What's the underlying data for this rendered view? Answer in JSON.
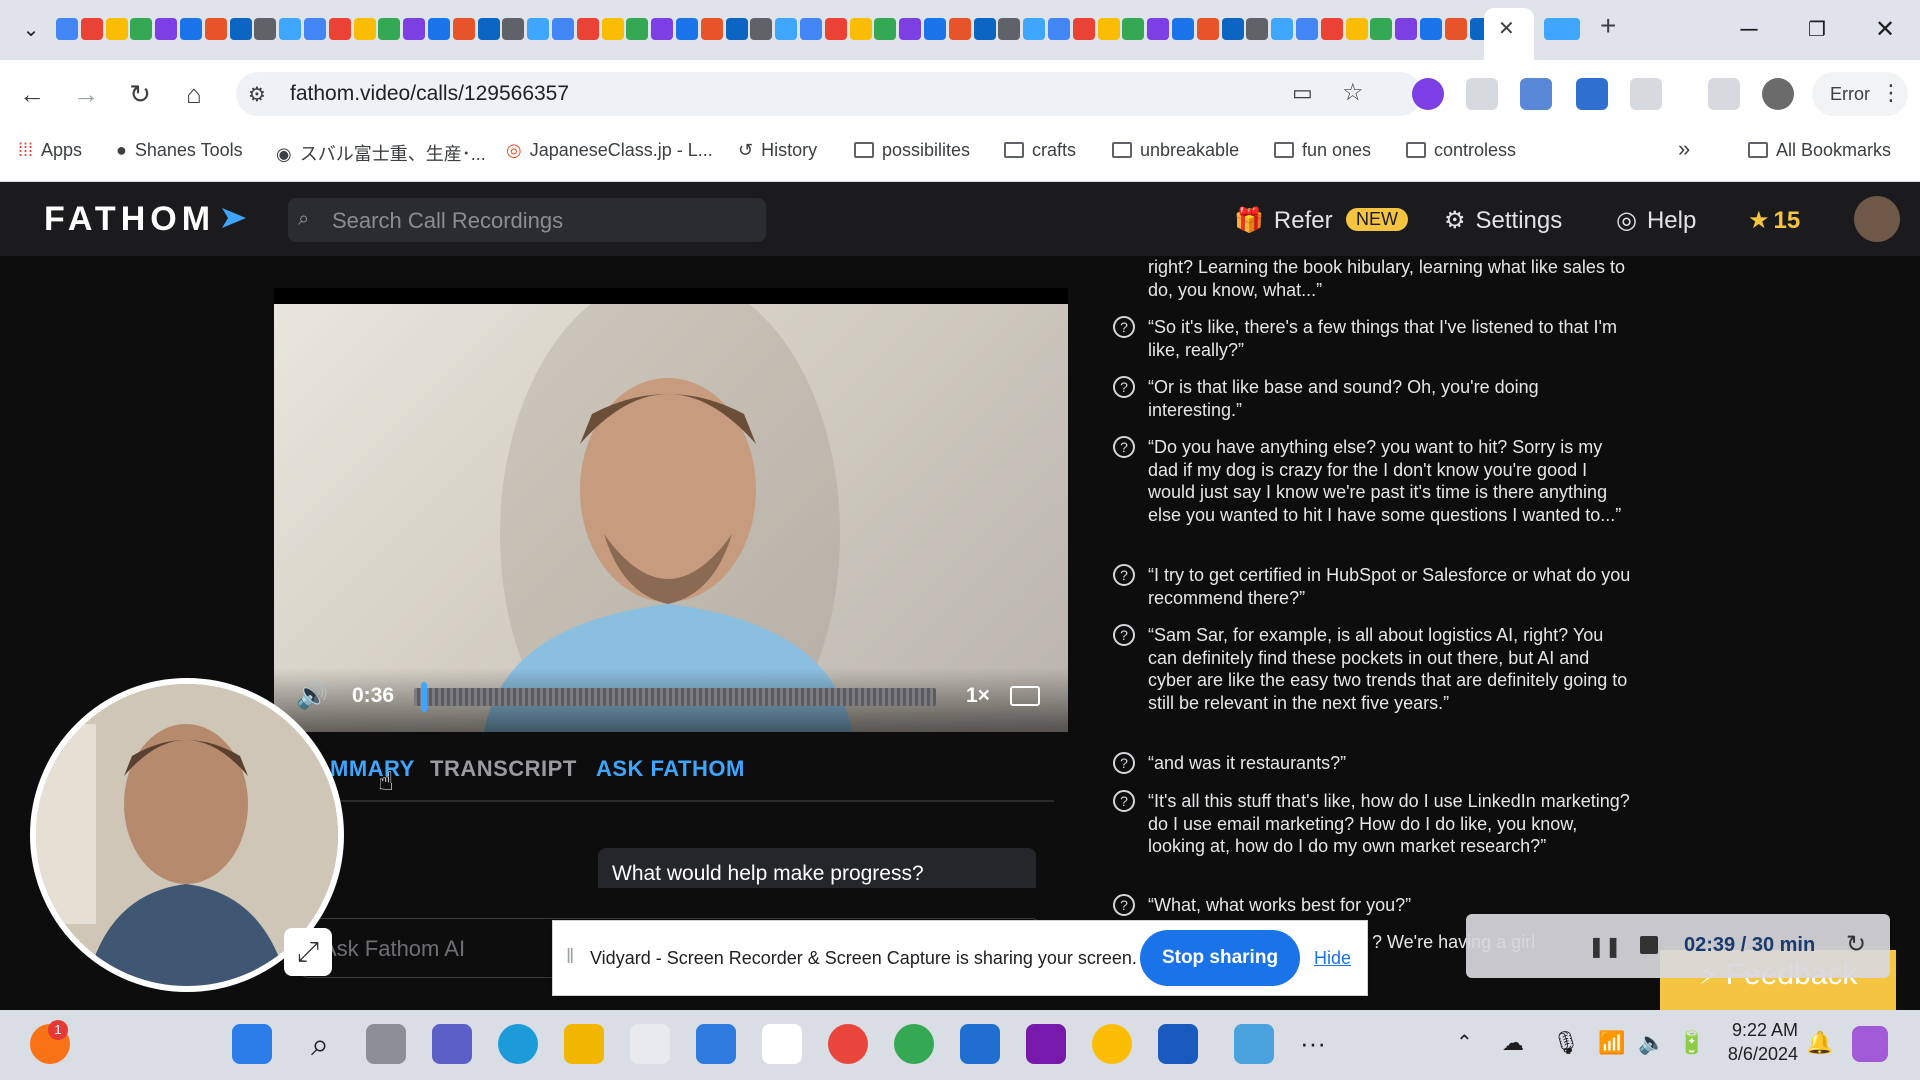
{
  "browser": {
    "url": "fathom.video/calls/129566357",
    "profile_label": "Error",
    "new_tab_glyph": "+",
    "close_tab_glyph": "✕",
    "bookmarks": [
      "Apps",
      "Shanes Tools",
      "スバル富士重、生産･...",
      "JapaneseClass.jp - L...",
      "History",
      "possibilites",
      "crafts",
      "unbreakable",
      "fun ones",
      "controless"
    ],
    "bookmarks_overflow": "»",
    "all_bookmarks": "All Bookmarks"
  },
  "fathom": {
    "logo": "FATHOM",
    "search_placeholder": "Search Call Recordings",
    "refer_label": "Refer",
    "new_badge": "NEW",
    "settings_label": "Settings",
    "help_label": "Help",
    "star_count": "15",
    "player": {
      "time": "0:36",
      "speed": "1×",
      "progress": 0.02
    },
    "tabs": [
      "SUMMARY",
      "TRANSCRIPT",
      "ASK FATHOM"
    ],
    "tabs_visible": [
      "MMARY",
      "TRANSCRIPT",
      "ASK FATHOM"
    ],
    "active_tab": "ASK FATHOM",
    "question_bubble": "What would help make progress?",
    "ask_placeholder": "Ask Fathom AI",
    "questions": [
      "right? Learning the book hibulary, learning what like sales to do, you know, what...”",
      "“So it's like, there's a few things that I've listened to that I'm like, really?”",
      "“Or is that like base and sound? Oh, you're doing interesting.”",
      "“Do you have anything else? you want to hit? Sorry is my dad if my dog is crazy for the I don't know you're good I would just say I know we're past it's time is there anything else you wanted to hit I have some questions I wanted to...”",
      "“I try to get certified in HubSpot or Salesforce or what do you recommend there?”",
      "“Sam Sar, for example, is all about logistics AI, right? You can definitely find these pockets in out there, but AI and cyber are like the easy two trends that are definitely going to still be relevant in the next five years.”",
      "“and was it restaurants?”",
      "“It's all this stuff that's like, how do I use LinkedIn marketing? do I use email marketing? How do I do like, you know, looking at, how do I do my own market research?”",
      "“What, what works best for you?”"
    ],
    "partial_last": "? We're having a girl"
  },
  "share_banner": {
    "message": "Vidyard - Screen Recorder & Screen Capture is sharing your screen.",
    "stop_label": "Stop sharing",
    "hide_label": "Hide"
  },
  "recorder": {
    "time": "02:39 / 30 min",
    "feedback_label": "Feedback"
  },
  "taskbar": {
    "time": "9:22 AM",
    "date": "8/6/2024",
    "notification_count": "1"
  }
}
